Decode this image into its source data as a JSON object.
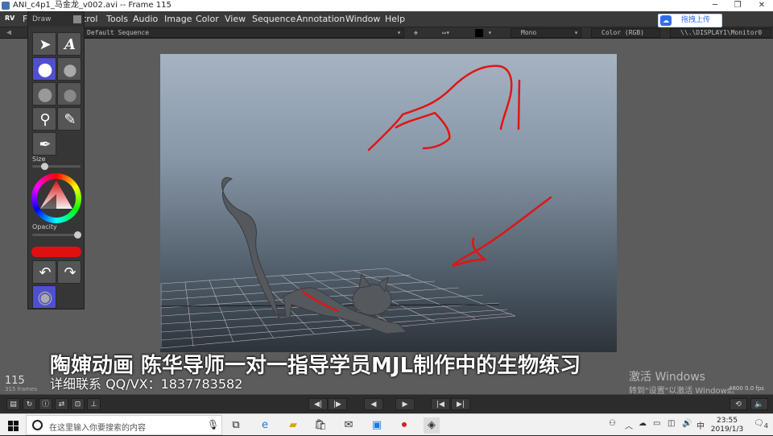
{
  "window": {
    "title": "ANI_c4p1_马金龙_v002.avi -- Frame 115"
  },
  "menu": {
    "logo": "RV",
    "items": [
      "F",
      "trol",
      "Tools",
      "Audio",
      "Image",
      "Color",
      "View",
      "Sequence",
      "Annotation",
      "Window",
      "Help"
    ]
  },
  "baidu": {
    "label": "拖拽上传"
  },
  "toolbar": {
    "sequence": "Default Sequence",
    "channel": "Mono",
    "color": "Color (RGB)",
    "display": "\\\\.\\DISPLAY1\\Monitor0"
  },
  "draw_panel": {
    "title": "Draw",
    "size_label": "Size",
    "opacity_label": "Opacity",
    "size_value": 0.2,
    "opacity_value": 0.95,
    "stroke_color": "#e01010"
  },
  "viewer": {
    "frame": "115",
    "frame_count": "315 frames",
    "fps_readout": "4800  0.0  fps"
  },
  "subtitles": {
    "main": "陶婶动画  陈华导师一对一指导学员MJL制作中的生物练习",
    "contact": "详细联系 QQ/VX：1837783582"
  },
  "activation": {
    "line1": "激活 Windows",
    "line2": "转到\"设置\"以激活 Windows。"
  },
  "taskbar": {
    "search_placeholder": "在这里输入你要搜索的内容",
    "ime": "中",
    "time": "23:55",
    "date": "2019/1/3",
    "notifications": "4"
  }
}
